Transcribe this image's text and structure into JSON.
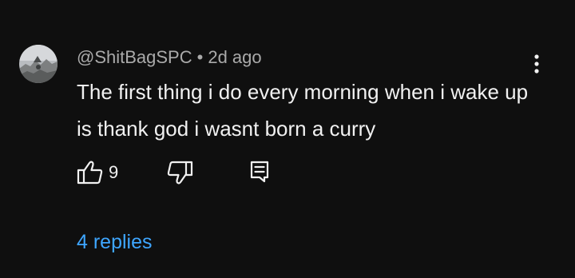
{
  "comment": {
    "author": "@ShitBagSPC",
    "separator": "•",
    "time": "2d ago",
    "text": "The first thing i do every morning when i wake up is thank god i wasnt born a curry",
    "like_count": "9",
    "replies_label": "4 replies"
  },
  "icons": {
    "avatar": "avatar-image",
    "more": "more-vert-icon",
    "like": "thumb-up-icon",
    "dislike": "thumb-down-icon",
    "reply": "reply-comment-icon"
  },
  "colors": {
    "background": "#0f0f0f",
    "text_primary": "#f1f1f1",
    "text_secondary": "#aaaaaa",
    "link": "#3ea6ff"
  }
}
